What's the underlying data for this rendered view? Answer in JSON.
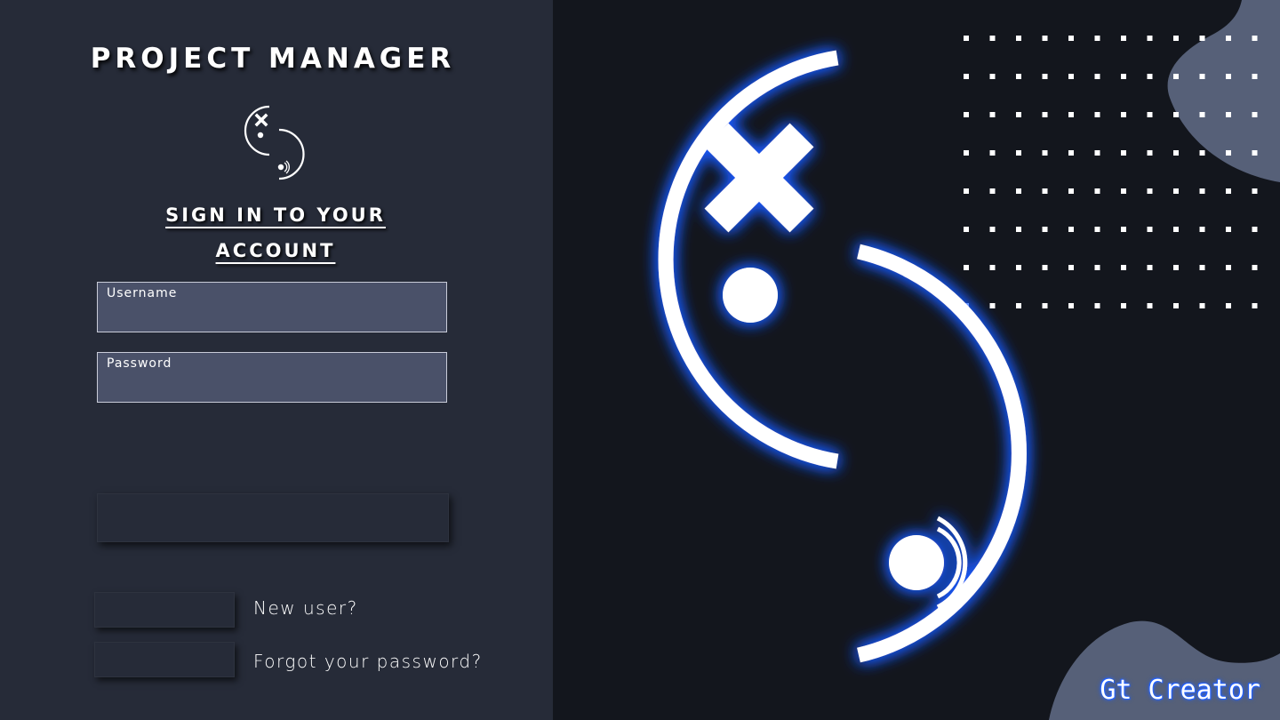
{
  "app": {
    "title": "PROJECT MANAGER"
  },
  "signin": {
    "subtitle_line1": "SIGN IN TO YOUR",
    "subtitle_line2": "ACCOUNT",
    "username_label": "Username",
    "username_value": "",
    "password_label": "Password",
    "password_value": "",
    "submit_label": ""
  },
  "links": {
    "new_user": "New user?",
    "forgot_password": "Forgot your password?"
  },
  "footer": {
    "credit": "Gt Creator"
  },
  "colors": {
    "left_panel": "#262b38",
    "right_panel": "#13161d",
    "input_fill": "#4a5169",
    "glow": "#1e5bff",
    "blob": "#566078"
  }
}
